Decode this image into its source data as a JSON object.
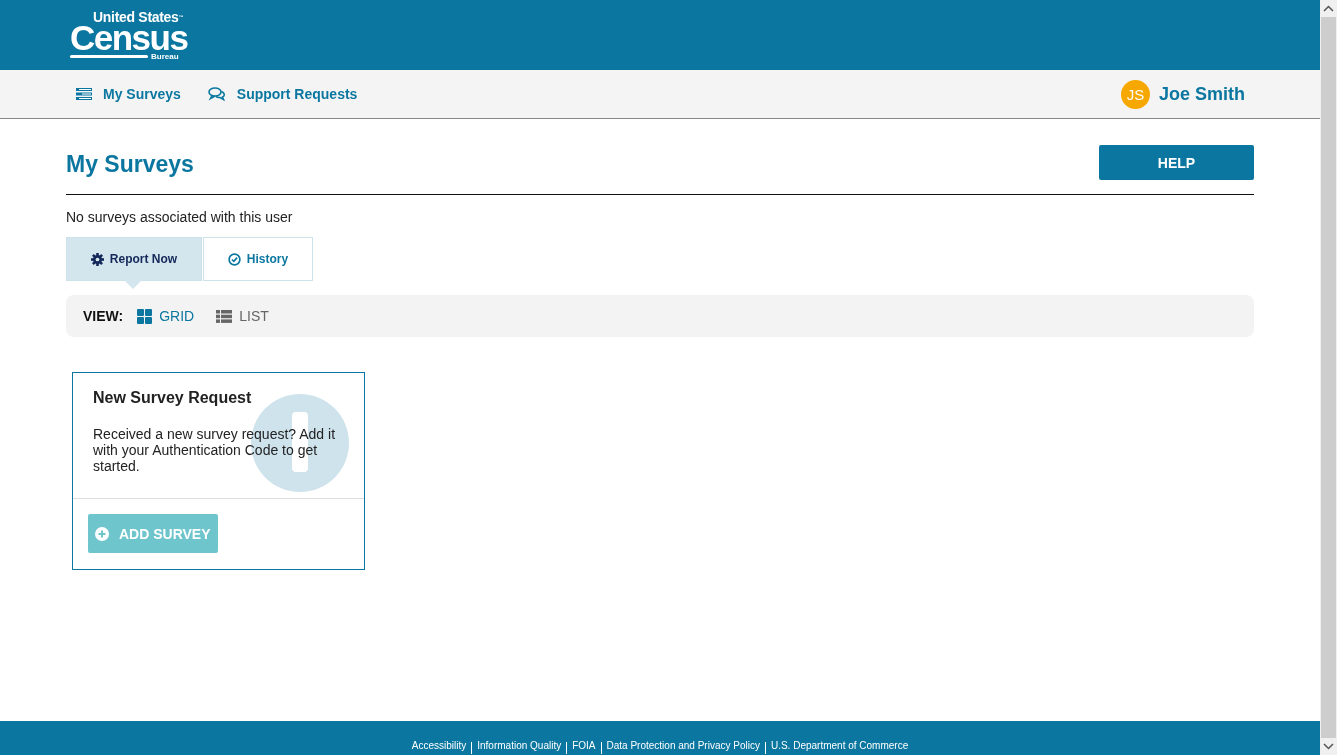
{
  "logo": {
    "top": "United States",
    "trademark": "™",
    "main": "Census",
    "sub": "Bureau"
  },
  "nav": {
    "items": [
      {
        "kind": "surveys",
        "label": "My Surveys"
      },
      {
        "kind": "support",
        "label": "Support Requests"
      }
    ],
    "user": {
      "initials": "JS",
      "name": "Joe Smith"
    }
  },
  "page": {
    "title": "My Surveys",
    "help_button": "HELP",
    "message": "No surveys associated with this user"
  },
  "tabs": [
    {
      "kind": "gear",
      "label": "Report Now",
      "selected": true
    },
    {
      "kind": "check",
      "label": "History",
      "selected": false
    }
  ],
  "view": {
    "label": "VIEW:",
    "options": [
      {
        "kind": "grid",
        "label": "GRID",
        "selected": true
      },
      {
        "kind": "list",
        "label": "LIST",
        "selected": false
      }
    ]
  },
  "card": {
    "title": "New Survey Request",
    "text": "Received a new survey request? Add it with your Authentication Code to get started.",
    "button": "ADD SURVEY"
  },
  "footer": {
    "links": [
      "Accessibility",
      "Information Quality",
      "FOIA",
      "Data Protection and Privacy Policy",
      "U.S. Department of Commerce"
    ]
  }
}
